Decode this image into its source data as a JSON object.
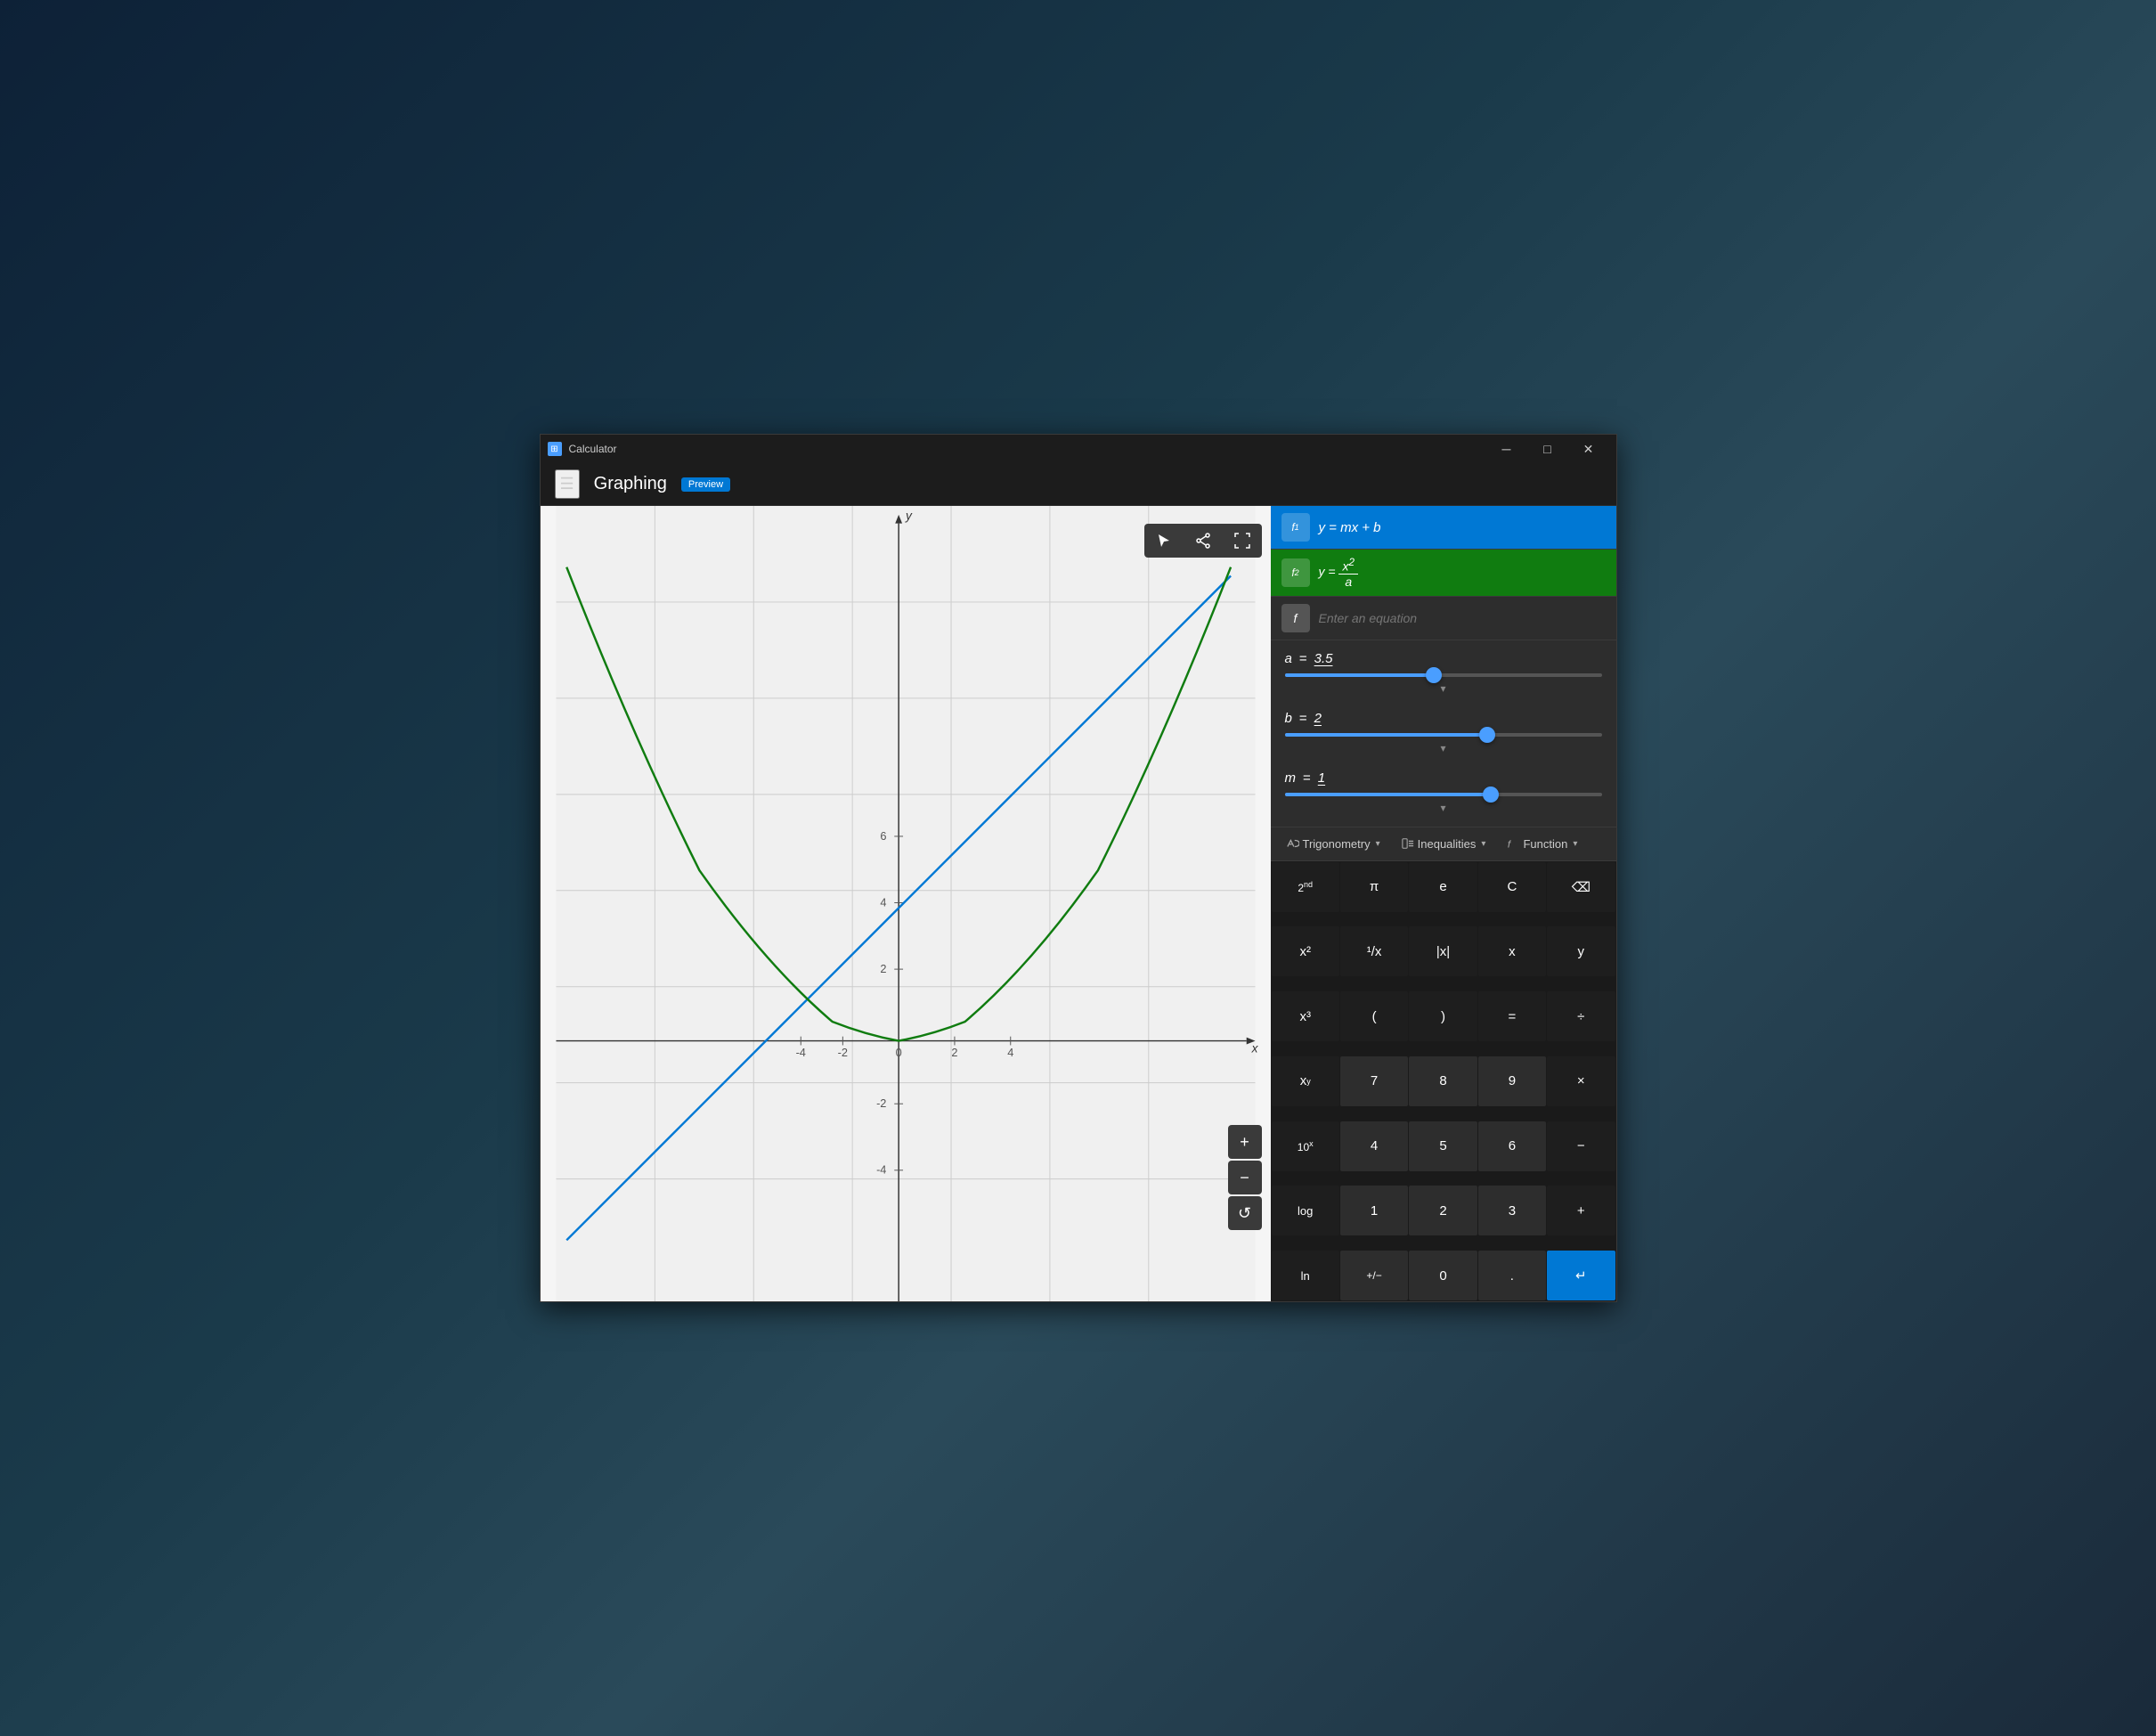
{
  "titleBar": {
    "appName": "Calculator",
    "minBtn": "─",
    "maxBtn": "□",
    "closeBtn": "✕"
  },
  "header": {
    "title": "Graphing",
    "badge": "Preview"
  },
  "equations": [
    {
      "id": "f1",
      "label": "f₁",
      "color": "blue",
      "text": "y = mx + b"
    },
    {
      "id": "f2",
      "label": "f₂",
      "color": "green",
      "text": "y = x² / a"
    },
    {
      "id": "f3",
      "label": "f",
      "color": "gray",
      "placeholder": "Enter an equation"
    }
  ],
  "variables": [
    {
      "name": "a",
      "value": "3.5",
      "thumbPercent": 47
    },
    {
      "name": "b",
      "value": "2",
      "thumbPercent": 64
    },
    {
      "name": "m",
      "value": "1",
      "thumbPercent": 65
    }
  ],
  "keyboardToolbar": [
    {
      "id": "trig",
      "icon": "trig",
      "label": "Trigonometry"
    },
    {
      "id": "ineq",
      "icon": "ineq",
      "label": "Inequalities"
    },
    {
      "id": "func",
      "icon": "func",
      "label": "Function"
    }
  ],
  "keypad": [
    [
      {
        "label": "2ⁿᵈ",
        "type": "dark"
      },
      {
        "label": "π",
        "type": "dark"
      },
      {
        "label": "e",
        "type": "dark"
      },
      {
        "label": "C",
        "type": "dark"
      },
      {
        "label": "⌫",
        "type": "dark"
      }
    ],
    [
      {
        "label": "x²",
        "type": "dark"
      },
      {
        "label": "¹/x",
        "type": "dark"
      },
      {
        "label": "|x|",
        "type": "dark"
      },
      {
        "label": "x",
        "type": "dark"
      },
      {
        "label": "y",
        "type": "dark"
      }
    ],
    [
      {
        "label": "x³",
        "type": "dark"
      },
      {
        "label": "(",
        "type": "dark"
      },
      {
        "label": ")",
        "type": "dark"
      },
      {
        "label": "=",
        "type": "dark"
      },
      {
        "label": "÷",
        "type": "dark"
      }
    ],
    [
      {
        "label": "xʸ",
        "type": "dark"
      },
      {
        "label": "7",
        "type": "normal"
      },
      {
        "label": "8",
        "type": "normal"
      },
      {
        "label": "9",
        "type": "normal"
      },
      {
        "label": "×",
        "type": "dark"
      }
    ],
    [
      {
        "label": "10ˣ",
        "type": "dark"
      },
      {
        "label": "4",
        "type": "normal"
      },
      {
        "label": "5",
        "type": "normal"
      },
      {
        "label": "6",
        "type": "normal"
      },
      {
        "label": "−",
        "type": "dark"
      }
    ],
    [
      {
        "label": "log",
        "type": "dark"
      },
      {
        "label": "1",
        "type": "normal"
      },
      {
        "label": "2",
        "type": "normal"
      },
      {
        "label": "3",
        "type": "normal"
      },
      {
        "label": "+",
        "type": "dark"
      }
    ],
    [
      {
        "label": "ln",
        "type": "dark"
      },
      {
        "label": "+/−",
        "type": "normal"
      },
      {
        "label": "0",
        "type": "normal"
      },
      {
        "label": ".",
        "type": "normal"
      },
      {
        "label": "↵",
        "type": "accent"
      }
    ]
  ],
  "graph": {
    "xMin": -5,
    "xMax": 5,
    "yMin": -5,
    "yMax": 8,
    "xLabels": [
      "-4",
      "-2",
      "0",
      "2",
      "4"
    ],
    "yLabels": [
      "-4",
      "-2",
      "2",
      "4",
      "6"
    ]
  },
  "colors": {
    "background": "#1c1c1c",
    "graphBg": "#f0f0f0",
    "accent": "#0078d4",
    "green": "#107c10",
    "blue": "#4a9eff",
    "sliderTrack": "#555555"
  }
}
